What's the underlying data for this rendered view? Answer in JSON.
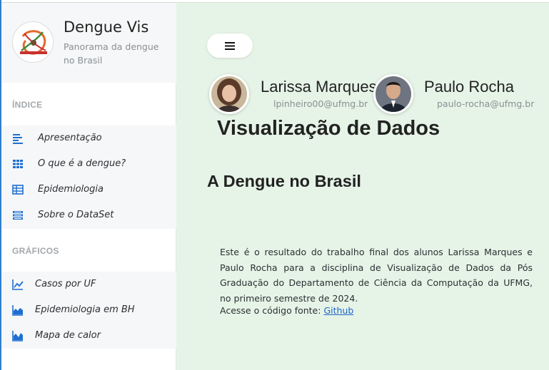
{
  "brand": {
    "title": "Dengue Vis",
    "subtitle": "Panorama da dengue no Brasil",
    "logo_icon": "dengue-logo-icon"
  },
  "sidebar": {
    "index_label": "ÍNDICE",
    "index_items": [
      {
        "label": "Apresentação",
        "icon": "align-left-icon"
      },
      {
        "label": "O que é a dengue?",
        "icon": "grid-icon"
      },
      {
        "label": "Epidemiologia",
        "icon": "table-icon"
      },
      {
        "label": "Sobre o DataSet",
        "icon": "list-icon"
      }
    ],
    "charts_label": "GRÁFICOS",
    "chart_items": [
      {
        "label": "Casos por UF",
        "icon": "line-chart-icon"
      },
      {
        "label": "Epidemiologia em BH",
        "icon": "bar-chart-icon"
      },
      {
        "label": "Mapa de calor",
        "icon": "area-chart-icon"
      }
    ]
  },
  "toolbar": {
    "menu_icon": "hamburger-menu-icon"
  },
  "authors": [
    {
      "name": "Larissa Marques",
      "email": "lpinheiro00@ufmg.br"
    },
    {
      "name": "Paulo Rocha",
      "email": "paulo-rocha@ufmg.br"
    }
  ],
  "main": {
    "page_title": "Visualização de Dados",
    "section_title": "A Dengue no Brasil",
    "intro_text": "Este é o resultado do trabalho final dos alunos Larissa Marques e Paulo Rocha para a disciplina de Visualização de Dados da Pós Graduação do Departamento de Ciência da Computação da UFMG, no primeiro semestre de 2024.",
    "source_prefix": "Acesse o código fonte: ",
    "source_link": "Github"
  },
  "colors": {
    "accent": "#1e6fd0",
    "content_bg": "#e6f4e7",
    "sidebar_bg": "#f6f7f8"
  }
}
